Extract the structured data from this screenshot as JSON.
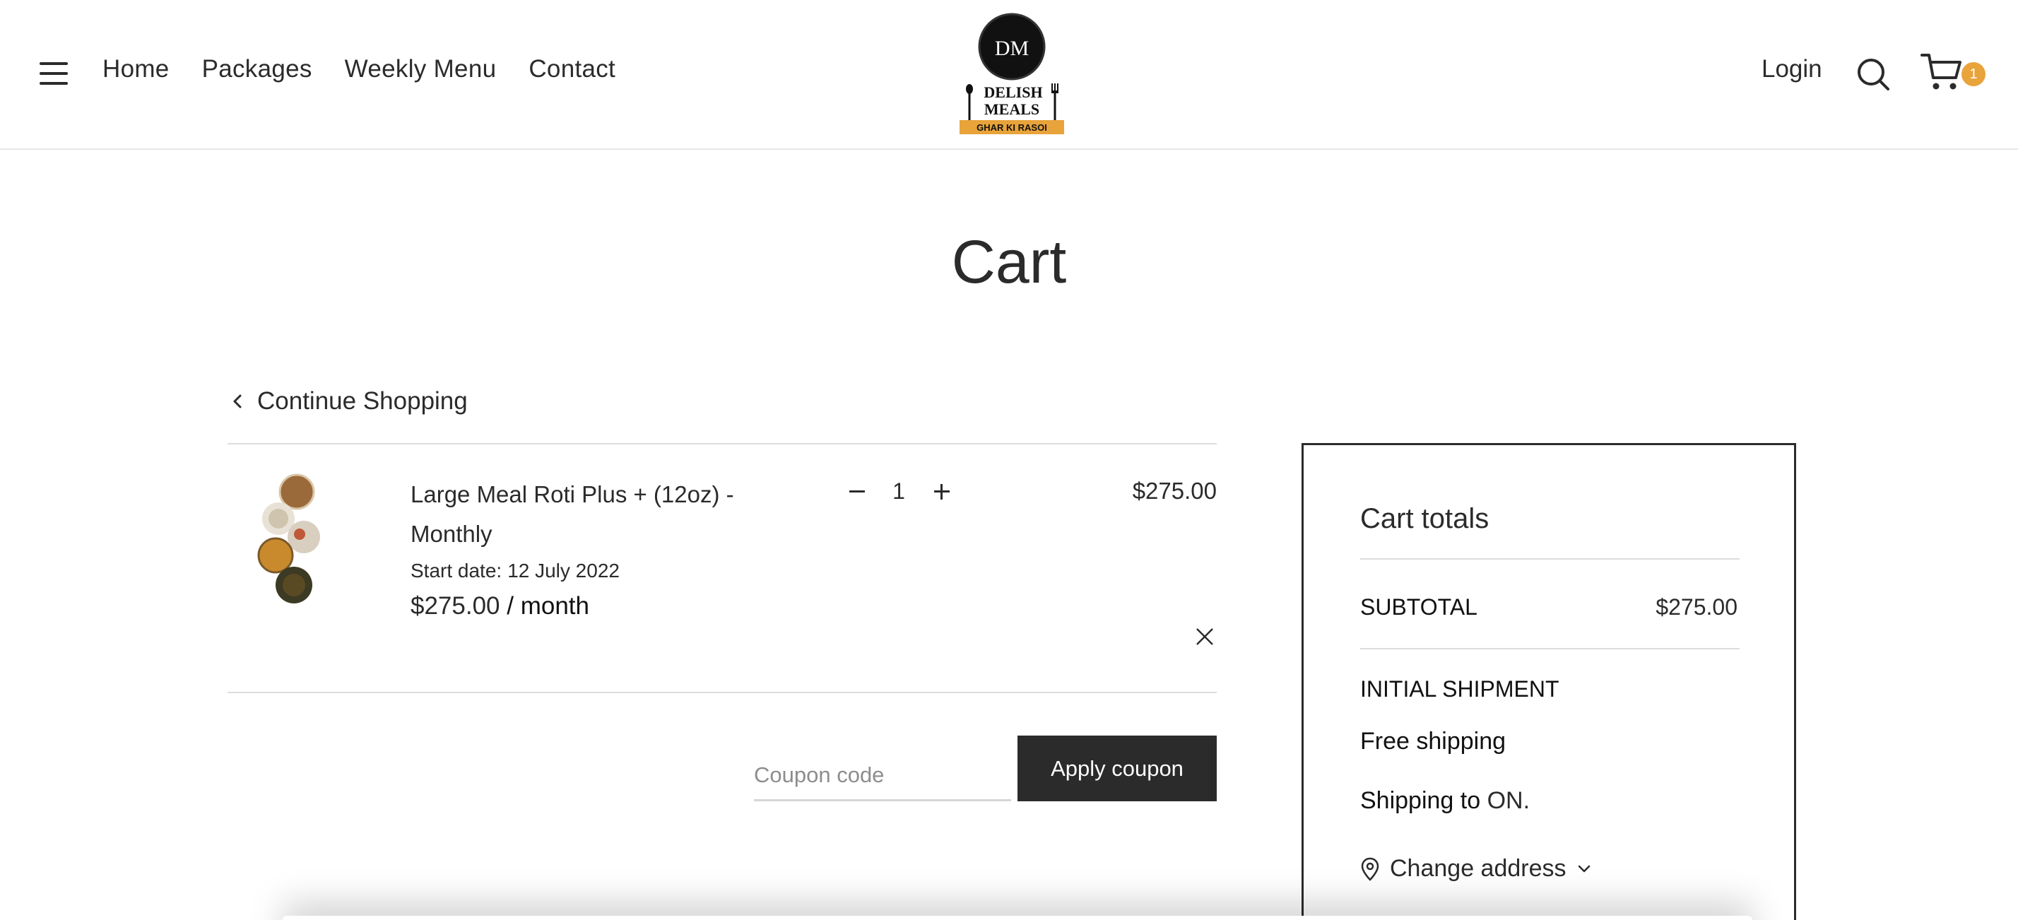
{
  "header": {
    "nav": [
      "Home",
      "Packages",
      "Weekly Menu",
      "Contact"
    ],
    "logo": {
      "monogram": "DM",
      "line1": "DELISH",
      "line2": "MEALS",
      "tagline": "GHAR KI RASOI",
      "accent": "#e8a33a"
    },
    "login_label": "Login",
    "cart_count": "1"
  },
  "page_title": "Cart",
  "continue_label": "Continue Shopping",
  "item": {
    "name": "Large Meal Roti Plus + (12oz) - Monthly",
    "start_label": "Start date:",
    "start_value": "12 July 2022",
    "price": "$275.00",
    "per": " / month",
    "quantity": "1",
    "total": "$275.00"
  },
  "coupon": {
    "placeholder": "Coupon code",
    "button_label": "Apply coupon"
  },
  "totals": {
    "heading": "Cart totals",
    "subtotal_label": "SUBTOTAL",
    "subtotal_value": "$275.00",
    "shipment_label": "INITIAL SHIPMENT",
    "shipping_method": "Free shipping",
    "shipping_to_label": "Shipping to",
    "shipping_to_value": "ON.",
    "change_address_label": "Change address"
  },
  "colors": {
    "text": "#2b2b2b",
    "button_bg": "#2b2b2b",
    "badge": "#e8a33a",
    "rule": "#dcdcdc"
  }
}
